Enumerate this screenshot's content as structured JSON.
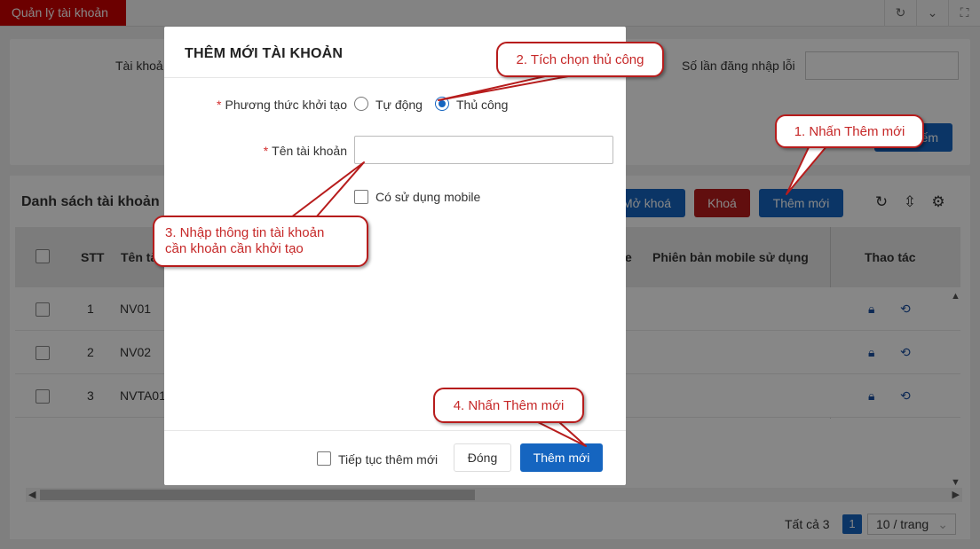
{
  "tabbar": {
    "active_tab": "Quản lý tài khoản"
  },
  "search": {
    "account_label": "Tài khoả",
    "login_error_label": "Số lần đăng nhập lỗi",
    "search_button": "ếm"
  },
  "list": {
    "title": "Danh sách tài khoản",
    "unlock_button": "Mở khoá",
    "lock_button": "Khoá",
    "add_button": "Thêm mới",
    "columns": {
      "stt": "STT",
      "account": "Tên tà",
      "partial": "e",
      "mobile_version": "Phiên bản mobile sử dụng",
      "actions": "Thao tác"
    },
    "rows": [
      {
        "stt": "1",
        "account": "NV01"
      },
      {
        "stt": "2",
        "account": "NV02"
      },
      {
        "stt": "3",
        "account": "NVTA01"
      }
    ]
  },
  "pager": {
    "total": "Tất cả 3",
    "page": "1",
    "size": "10 / trang"
  },
  "modal": {
    "title": "THÊM MỚI TÀI KHOẢN",
    "method_label": "Phương thức khởi tạo",
    "required_mark": "*",
    "options": [
      "Tự động",
      "Thủ công"
    ],
    "selected_option": "Thủ công",
    "account_label": "Tên tài khoản",
    "account_value": "",
    "mobile_checkbox": "Có sử dụng mobile",
    "continue_checkbox": "Tiếp tục thêm mới",
    "close_button": "Đóng",
    "submit_button": "Thêm mới"
  },
  "callouts": {
    "step1": "1. Nhấn Thêm mới",
    "step2": "2. Tích chọn thủ công",
    "step3_line1": "3. Nhập thông tin tài khoản",
    "step3_line2": "cần khoản cần khởi tạo",
    "step4": "4. Nhấn Thêm mới"
  },
  "colors": {
    "primary": "#1565c0",
    "danger": "#b71c1c",
    "callout_text": "#c62828"
  }
}
